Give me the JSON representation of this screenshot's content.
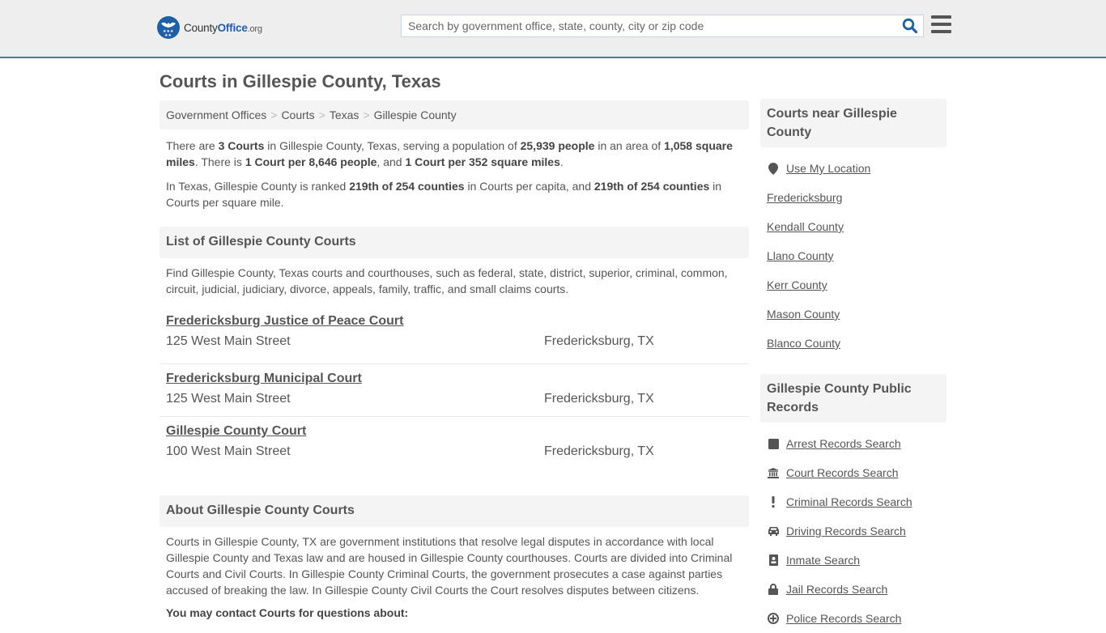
{
  "header": {
    "logo": {
      "name_part1": "County",
      "name_part2": "Office",
      "tld": ".org"
    },
    "search": {
      "placeholder": "Search by government office, state, county, city or zip code",
      "value": ""
    },
    "colors": {
      "accent": "#3a7eb0",
      "brand": "#1f5fa3",
      "header_bg": "#eeeeee"
    }
  },
  "page": {
    "title": "Courts in Gillespie County, Texas",
    "breadcrumb": [
      {
        "label": "Government Offices"
      },
      {
        "label": "Courts"
      },
      {
        "label": "Texas"
      },
      {
        "label": "Gillespie County"
      }
    ],
    "breadcrumb_sep": ">",
    "intro": {
      "p1": {
        "t1": "There are ",
        "b1": "3 Courts",
        "t2": " in Gillespie County, Texas, serving a population of ",
        "b2": "25,939 people",
        "t3": " in an area of ",
        "b3": "1,058 square miles",
        "t4": ". There is ",
        "b4": "1 Court per 8,646 people",
        "t5": ", and ",
        "b5": "1 Court per 352 square miles",
        "t6": "."
      },
      "p2": {
        "t1": "In Texas, Gillespie County is ranked ",
        "b1": "219th of 254 counties",
        "t2": " in Courts per capita, and ",
        "b2": "219th of 254 counties",
        "t3": " in Courts per square mile."
      }
    },
    "list_section": {
      "heading": "List of Gillespie County Courts",
      "description": "Find Gillespie County, Texas courts and courthouses, such as federal, state, district, superior, criminal, common, circuit, judicial, judiciary, divorce, appeals, family, traffic, and small claims courts.",
      "courts": [
        {
          "name": "Fredericksburg Justice of Peace Court",
          "address": "125 West Main Street",
          "city": "Fredericksburg, TX"
        },
        {
          "name": "Fredericksburg Municipal Court",
          "address": "125 West Main Street",
          "city": "Fredericksburg, TX"
        },
        {
          "name": "Gillespie County Court",
          "address": "100 West Main Street",
          "city": "Fredericksburg, TX"
        }
      ]
    },
    "about_section": {
      "heading": "About Gillespie County Courts",
      "text": "Courts in Gillespie County, TX are government institutions that resolve legal disputes in accordance with local Gillespie County and Texas law and are housed in Gillespie County courthouses. Courts are divided into Criminal Courts and Civil Courts. In Gillespie County Criminal Courts, the government prosecutes a case against parties accused of breaking the law. In Gillespie County Civil Courts the Court resolves disputes between citizens.",
      "contact_question": "You may contact Courts for questions about:"
    }
  },
  "sidebar": {
    "nearby": {
      "heading": "Courts near Gillespie County",
      "use_location": {
        "label": "Use My Location",
        "icon": "map-marker-icon"
      },
      "items": [
        {
          "label": "Fredericksburg"
        },
        {
          "label": "Kendall County"
        },
        {
          "label": "Llano County"
        },
        {
          "label": "Kerr County"
        },
        {
          "label": "Mason County"
        },
        {
          "label": "Blanco County"
        }
      ]
    },
    "records": {
      "heading": "Gillespie County Public Records",
      "items": [
        {
          "label": "Arrest Records Search",
          "icon": "square-icon"
        },
        {
          "label": "Court Records Search",
          "icon": "courthouse-icon"
        },
        {
          "label": "Criminal Records Search",
          "icon": "exclamation-icon"
        },
        {
          "label": "Driving Records Search",
          "icon": "car-icon"
        },
        {
          "label": "Inmate Search",
          "icon": "id-badge-icon"
        },
        {
          "label": "Jail Records Search",
          "icon": "lock-icon"
        },
        {
          "label": "Police Records Search",
          "icon": "police-icon"
        }
      ]
    }
  }
}
